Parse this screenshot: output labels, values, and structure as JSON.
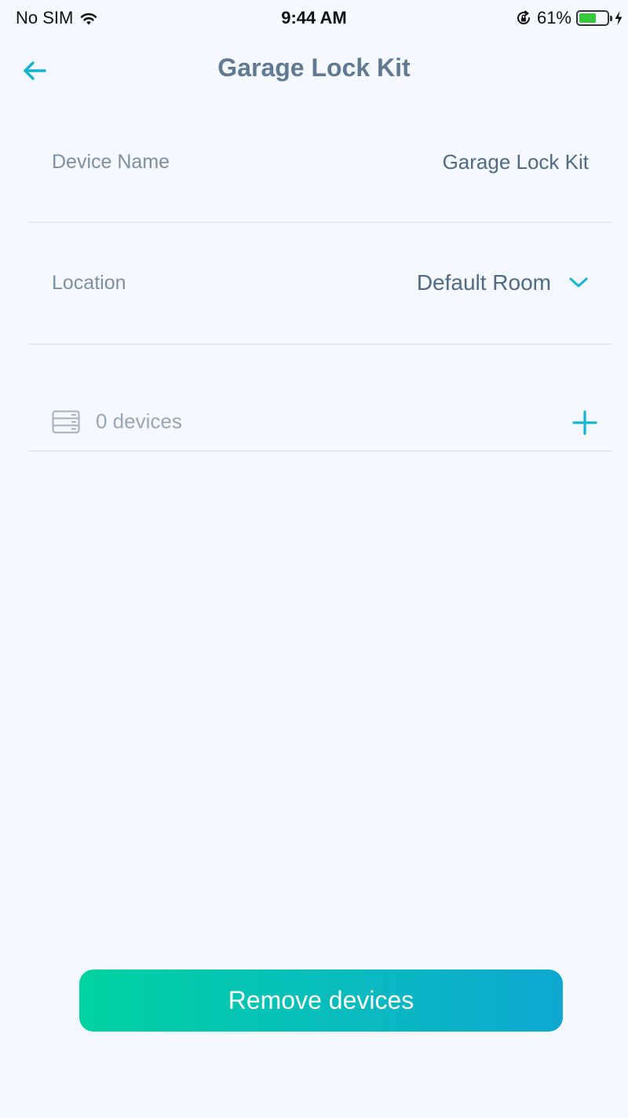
{
  "status_bar": {
    "carrier": "No SIM",
    "time": "9:44 AM",
    "battery_percent": "61%",
    "battery_level": 0.61,
    "icons": [
      "wifi-icon",
      "orientation-lock-icon",
      "battery-icon",
      "charging-icon"
    ]
  },
  "header": {
    "title": "Garage Lock Kit",
    "back_icon": "arrow-left-icon"
  },
  "settings": {
    "device_name_label": "Device Name",
    "device_name_value": "Garage Lock Kit",
    "location_label": "Location",
    "location_value": "Default Room",
    "devices_count": "0 devices"
  },
  "actions": {
    "remove_label": "Remove devices"
  },
  "colors": {
    "accent": "#14b3cf",
    "background": "#f5f8fd",
    "gradient_start": "#00d3a1",
    "gradient_end": "#0ea8d2"
  }
}
